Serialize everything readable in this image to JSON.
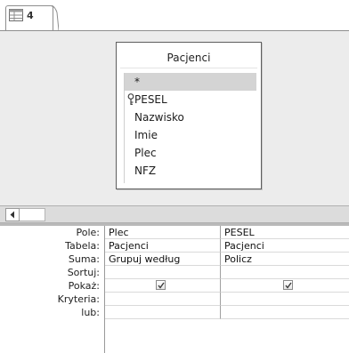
{
  "tab": {
    "title": "4",
    "icon": "query-icon"
  },
  "table": {
    "name": "Pacjenci",
    "fields": [
      {
        "label": "*",
        "selected": true,
        "key": false
      },
      {
        "label": "PESEL",
        "selected": false,
        "key": true
      },
      {
        "label": "Nazwisko",
        "selected": false,
        "key": false
      },
      {
        "label": "Imie",
        "selected": false,
        "key": false
      },
      {
        "label": "Plec",
        "selected": false,
        "key": false
      },
      {
        "label": "NFZ",
        "selected": false,
        "key": false
      }
    ]
  },
  "scrollbar": {
    "left_icon": "chevron-left-icon"
  },
  "grid": {
    "row_labels": {
      "pole": "Pole:",
      "tabela": "Tabela:",
      "suma": "Suma:",
      "sortuj": "Sortuj:",
      "pokaz": "Pokaż:",
      "kryteria": "Kryteria:",
      "lub": "lub:"
    },
    "columns": [
      {
        "pole": "Plec",
        "tabela": "Pacjenci",
        "suma": "Grupuj według",
        "sortuj": "",
        "pokaz": true,
        "kryteria": "",
        "lub": ""
      },
      {
        "pole": "PESEL",
        "tabela": "Pacjenci",
        "suma": "Policz",
        "sortuj": "",
        "pokaz": true,
        "kryteria": "",
        "lub": ""
      }
    ]
  }
}
